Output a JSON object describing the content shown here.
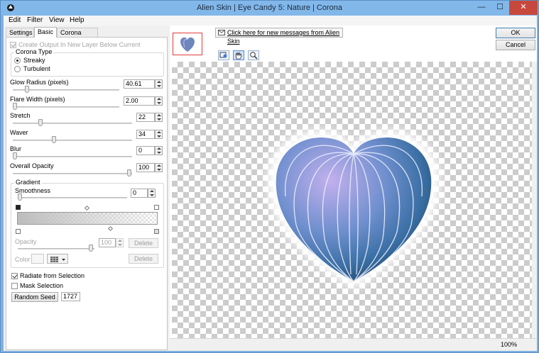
{
  "window": {
    "title": "Alien Skin | Eye Candy 5: Nature | Corona",
    "min_glyph": "—",
    "max_glyph": "☐",
    "close_glyph": "✕"
  },
  "menu": [
    "Edit",
    "Filter",
    "View",
    "Help"
  ],
  "tabs": [
    "Settings",
    "Basic",
    "Corona Offset"
  ],
  "basic": {
    "create_output_label": "Create Output In New Layer Below Current",
    "corona_type": {
      "label": "Corona Type",
      "options": [
        "Streaky",
        "Turbulent"
      ],
      "selected": "Streaky"
    },
    "glow_radius": {
      "label": "Glow Radius (pixels)",
      "value": "40.61"
    },
    "flare_width": {
      "label": "Flare Width (pixels)",
      "value": "2.00"
    },
    "stretch": {
      "label": "Stretch",
      "value": "22"
    },
    "waver": {
      "label": "Waver",
      "value": "34"
    },
    "blur": {
      "label": "Blur",
      "value": "0"
    },
    "overall_opacity": {
      "label": "Overall Opacity",
      "value": "100"
    },
    "gradient": {
      "label": "Gradient",
      "smoothness_label": "Smoothness",
      "smoothness_value": "0",
      "opacity_label": "Opacity",
      "opacity_value": "100",
      "color_label": "Color",
      "delete_label": "Delete"
    },
    "radiate_label": "Radiate from Selection",
    "mask_label": "Mask Selection",
    "random_seed_label": "Random Seed",
    "random_seed_value": "1727"
  },
  "right": {
    "message_link": "Click here for new messages from Alien Skin",
    "ok_label": "OK",
    "cancel_label": "Cancel",
    "tools": [
      "crop-preview-icon",
      "hand-icon",
      "zoom-icon"
    ],
    "zoom_text": "100%"
  },
  "colors": {
    "title_bar": "#82b7ea",
    "close_button": "#c7483d",
    "heart_light": "#b9a2e6",
    "heart_dark": "#1d3e63"
  }
}
